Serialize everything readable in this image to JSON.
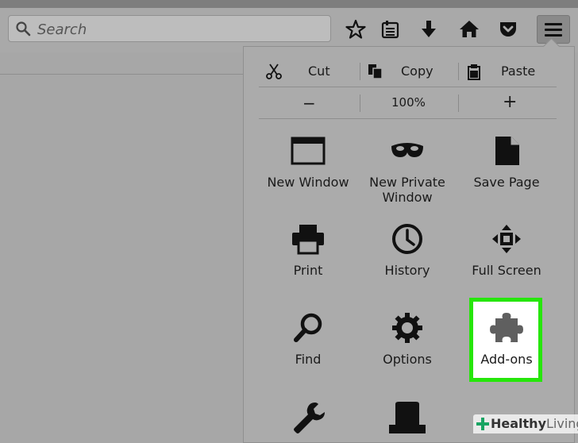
{
  "toolbar": {
    "search_placeholder": "Search",
    "icons": [
      "search-icon",
      "bookmark-star-icon",
      "reading-list-icon",
      "download-icon",
      "home-icon",
      "pocket-icon",
      "hamburger-menu-icon"
    ]
  },
  "menu": {
    "edit": {
      "cut": "Cut",
      "copy": "Copy",
      "paste": "Paste"
    },
    "zoom": {
      "minus": "−",
      "level": "100%",
      "plus": "+"
    },
    "items": [
      {
        "label": "New Window",
        "icon": "window-icon"
      },
      {
        "label": "New Private Window",
        "icon": "private-mask-icon"
      },
      {
        "label": "Save Page",
        "icon": "save-page-icon"
      },
      {
        "label": "Print",
        "icon": "printer-icon"
      },
      {
        "label": "History",
        "icon": "clock-icon"
      },
      {
        "label": "Full Screen",
        "icon": "fullscreen-icon"
      },
      {
        "label": "Find",
        "icon": "magnifier-icon"
      },
      {
        "label": "Options",
        "icon": "gear-icon"
      },
      {
        "label": "Add-ons",
        "icon": "puzzle-piece-icon"
      }
    ],
    "highlight_color": "#26e60a"
  },
  "watermark": {
    "brand": "Healthy",
    "brand_suffix": "Living"
  }
}
